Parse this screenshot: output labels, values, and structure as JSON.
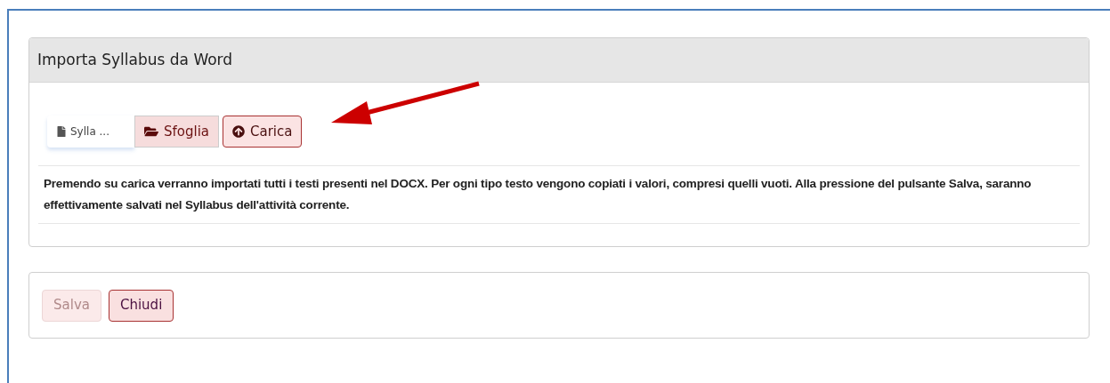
{
  "panel": {
    "title": "Importa Syllabus da Word",
    "file_field": {
      "value": "Sylla ..."
    },
    "buttons": [
      {
        "kind": "browse",
        "label": "Sfoglia"
      },
      {
        "kind": "upload",
        "label": "Carica"
      }
    ],
    "description": "Premendo su carica verranno importati tutti i testi presenti nel DOCX. Per ogni tipo testo vengono copiati i valori, compresi quelli vuoti. Alla pressione del pulsante Salva, saranno effettivamente salvati nel Syllabus dell'attività corrente."
  },
  "footer": {
    "buttons": [
      {
        "label": "Salva",
        "disabled": true
      },
      {
        "label": "Chiudi",
        "disabled": false
      }
    ]
  }
}
